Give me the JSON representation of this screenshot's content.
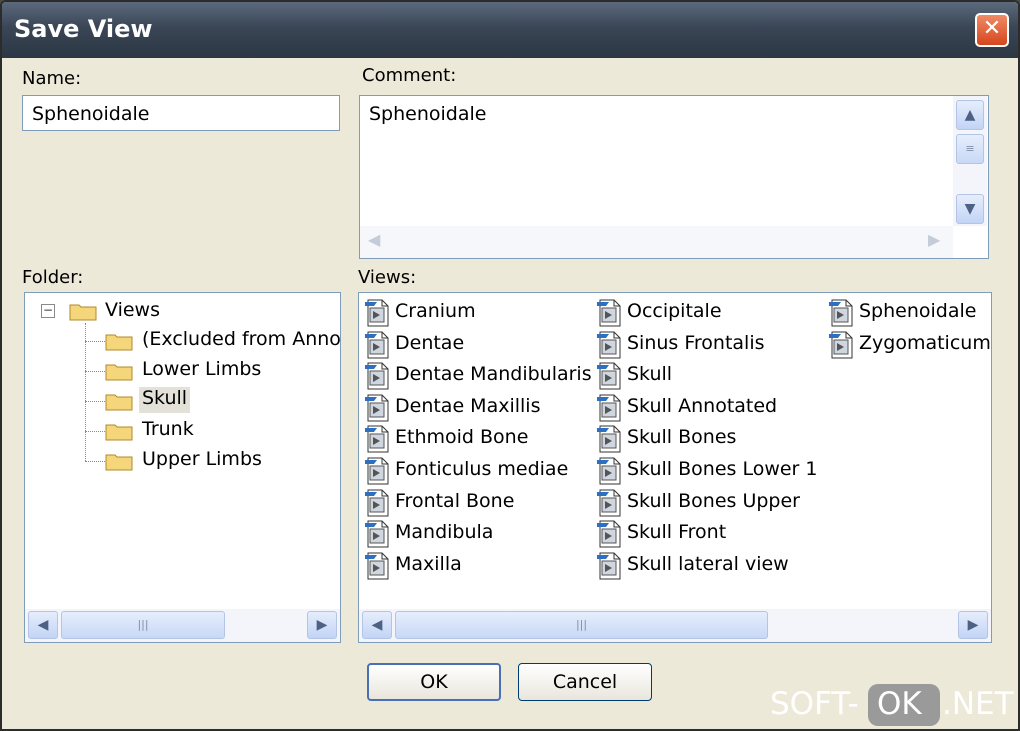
{
  "window": {
    "title": "Save View"
  },
  "name_field": {
    "label": "Name:",
    "value": "Sphenoidale"
  },
  "comment_field": {
    "label": "Comment:",
    "value": "Sphenoidale"
  },
  "folder": {
    "label": "Folder:",
    "root": "Views",
    "children": [
      "(Excluded from Annot",
      "Lower Limbs",
      "Skull",
      "Trunk",
      "Upper Limbs"
    ],
    "selected": "Skull"
  },
  "views": {
    "label": "Views:",
    "columns": [
      [
        "Cranium",
        "Dentae",
        "Dentae Mandibularis",
        "Dentae Maxillis",
        "Ethmoid Bone",
        "Fonticulus mediae",
        "Frontal Bone",
        "Mandibula",
        "Maxilla"
      ],
      [
        "Occipitale",
        "Sinus Frontalis",
        "Skull",
        "Skull Annotated",
        "Skull Bones",
        "Skull Bones Lower 1",
        "Skull Bones Upper",
        "Skull Front",
        "Skull lateral view"
      ],
      [
        "Sphenoidale",
        "Zygomaticum"
      ]
    ]
  },
  "buttons": {
    "ok": "OK",
    "cancel": "Cancel"
  },
  "watermark": {
    "left": "SOFT-",
    "middle": "OK",
    "right": ".NET"
  },
  "icons": {
    "close": "close-icon",
    "folder": "folder-icon",
    "view": "view-file-icon",
    "collapse": "tree-collapse-icon",
    "scroll_up": "chevron-up-icon",
    "scroll_down": "chevron-down-icon",
    "scroll_left": "chevron-left-icon",
    "scroll_right": "chevron-right-icon"
  },
  "colors": {
    "titlebar": "#3a4656",
    "close_button": "#d6461d",
    "dialog_bg": "#ece9d8",
    "field_border": "#7f9db9",
    "selection": "#e3e1d8"
  }
}
